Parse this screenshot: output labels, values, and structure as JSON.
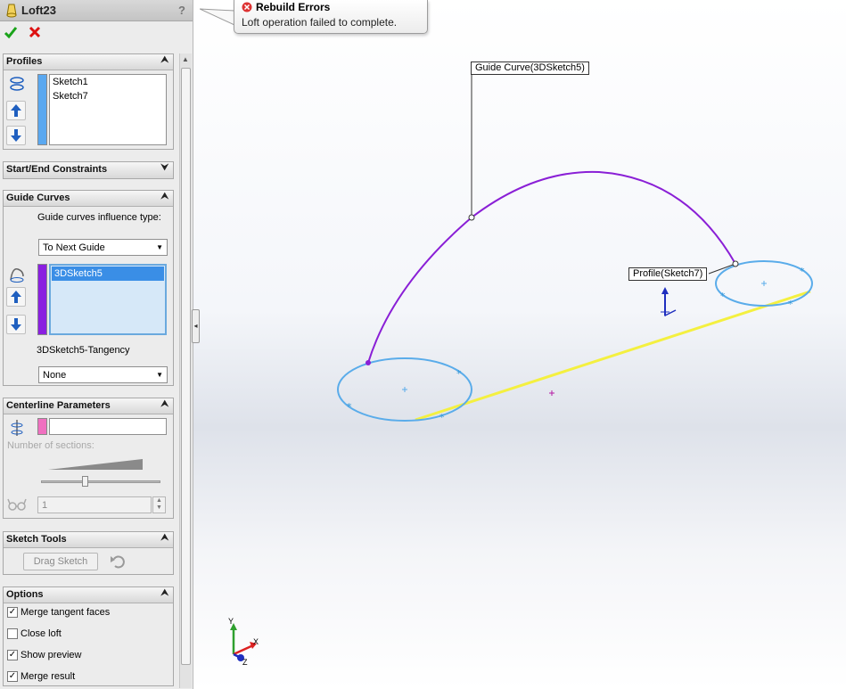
{
  "feature": {
    "title": "Loft23",
    "help": "?"
  },
  "actions": {
    "ok": "ok-check",
    "cancel": "cancel-x"
  },
  "error": {
    "title": "Rebuild Errors",
    "message": "Loft operation failed to complete."
  },
  "profiles": {
    "label": "Profiles",
    "items": [
      "Sketch1",
      "Sketch7"
    ],
    "color": "#5aa8f0"
  },
  "start_end": {
    "label": "Start/End Constraints"
  },
  "guide_curves": {
    "label": "Guide Curves",
    "influence_label": "Guide curves influence type:",
    "influence_value": "To Next Guide",
    "items": [
      "3DSketch5"
    ],
    "color": "#8a1fe0",
    "tangency_label": "3DSketch5-Tangency",
    "tangency_value": "None"
  },
  "centerline": {
    "label": "Centerline Parameters",
    "sections_label": "Number of sections:",
    "sections_value": "1",
    "color": "#f070c0"
  },
  "sketch_tools": {
    "label": "Sketch Tools",
    "drag_sketch": "Drag Sketch"
  },
  "options": {
    "label": "Options",
    "items": [
      {
        "label": "Merge tangent faces",
        "checked": true
      },
      {
        "label": "Close loft",
        "checked": false
      },
      {
        "label": "Show preview",
        "checked": true
      },
      {
        "label": "Merge result",
        "checked": true
      }
    ]
  },
  "callouts": {
    "guide": "Guide Curve(3DSketch5)",
    "profile": "Profile(Sketch7)"
  },
  "triad": {
    "x": "X",
    "y": "Y",
    "z": "Z"
  }
}
